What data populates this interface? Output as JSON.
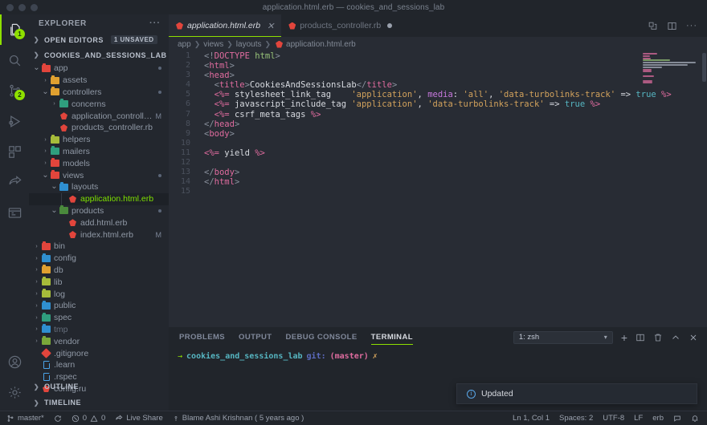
{
  "window": {
    "title": "application.html.erb — cookies_and_sessions_lab"
  },
  "activity_bar": {
    "items": [
      {
        "name": "explorer",
        "icon": "files-icon",
        "badge": "1",
        "active": true
      },
      {
        "name": "search",
        "icon": "search-icon",
        "badge": "",
        "active": false
      },
      {
        "name": "source-control",
        "icon": "source-control-icon",
        "badge": "2",
        "active": false
      },
      {
        "name": "run-and-debug",
        "icon": "run-debug-icon",
        "badge": "",
        "active": false
      },
      {
        "name": "extensions",
        "icon": "extensions-icon",
        "badge": "",
        "active": false
      },
      {
        "name": "live-share",
        "icon": "share-icon",
        "badge": "",
        "active": false
      },
      {
        "name": "remote-explorer",
        "icon": "remote-window-icon",
        "badge": "",
        "active": false
      }
    ],
    "bottom_items": [
      {
        "name": "accounts",
        "icon": "account-icon"
      },
      {
        "name": "manage-settings",
        "icon": "gear-icon"
      }
    ]
  },
  "sidebar": {
    "header": "EXPLORER",
    "more_actions": "···",
    "open_editors": {
      "label": "OPEN EDITORS",
      "badge": "1 UNSAVED",
      "collapsed": true
    },
    "project": {
      "label": "COOKIES_AND_SESSIONS_LAB",
      "collapsed": false
    },
    "tree": [
      {
        "label": "app",
        "type": "folder",
        "depth": 1,
        "open": true,
        "color": "#e2453c",
        "icon": "folder-app-icon",
        "flag": "",
        "dot": true
      },
      {
        "label": "assets",
        "type": "folder",
        "depth": 2,
        "open": false,
        "color": "#e0a030",
        "icon": "folder-assets-icon",
        "flag": "",
        "dot": false
      },
      {
        "label": "controllers",
        "type": "folder",
        "depth": 2,
        "open": true,
        "color": "#e0a030",
        "icon": "folder-controllers-icon",
        "flag": "",
        "dot": true
      },
      {
        "label": "concerns",
        "type": "folder",
        "depth": 3,
        "open": false,
        "color": "#2f9e7e",
        "icon": "folder-concerns-icon",
        "flag": "",
        "dot": false
      },
      {
        "label": "application_controller.rb",
        "type": "ruby",
        "depth": 3,
        "open": false,
        "color": "#e2453c",
        "icon": "ruby-file-icon",
        "flag": "M",
        "dot": false
      },
      {
        "label": "products_controller.rb",
        "type": "ruby",
        "depth": 3,
        "open": false,
        "color": "#e2453c",
        "icon": "ruby-file-icon",
        "flag": "",
        "dot": false
      },
      {
        "label": "helpers",
        "type": "folder",
        "depth": 2,
        "open": false,
        "color": "#a6bb3a",
        "icon": "folder-helpers-icon",
        "flag": "",
        "dot": false
      },
      {
        "label": "mailers",
        "type": "folder",
        "depth": 2,
        "open": false,
        "color": "#2f9e7e",
        "icon": "folder-mailers-icon",
        "flag": "",
        "dot": false
      },
      {
        "label": "models",
        "type": "folder",
        "depth": 2,
        "open": false,
        "color": "#e2453c",
        "icon": "folder-models-icon",
        "flag": "",
        "dot": false
      },
      {
        "label": "views",
        "type": "folder",
        "depth": 2,
        "open": true,
        "color": "#e2453c",
        "icon": "folder-views-icon",
        "flag": "",
        "dot": true
      },
      {
        "label": "layouts",
        "type": "folder",
        "depth": 3,
        "open": true,
        "color": "#2f8fd0",
        "icon": "folder-layouts-icon",
        "flag": "",
        "dot": false
      },
      {
        "label": "application.html.erb",
        "type": "ruby",
        "depth": 4,
        "open": false,
        "color": "#e2453c",
        "icon": "erb-file-icon",
        "flag": "",
        "dot": false,
        "selected": true
      },
      {
        "label": "products",
        "type": "folder",
        "depth": 3,
        "open": true,
        "color": "#4a8a3c",
        "icon": "folder-products-icon",
        "flag": "",
        "dot": true
      },
      {
        "label": "add.html.erb",
        "type": "ruby",
        "depth": 4,
        "open": false,
        "color": "#e2453c",
        "icon": "erb-file-icon",
        "flag": "",
        "dot": false
      },
      {
        "label": "index.html.erb",
        "type": "ruby",
        "depth": 4,
        "open": false,
        "color": "#e2453c",
        "icon": "erb-file-icon",
        "flag": "M",
        "dot": false
      },
      {
        "label": "bin",
        "type": "folder",
        "depth": 1,
        "open": false,
        "color": "#e2453c",
        "icon": "folder-bin-icon",
        "flag": "",
        "dot": false
      },
      {
        "label": "config",
        "type": "folder",
        "depth": 1,
        "open": false,
        "color": "#2f8fd0",
        "icon": "folder-config-icon",
        "flag": "",
        "dot": false
      },
      {
        "label": "db",
        "type": "folder",
        "depth": 1,
        "open": false,
        "color": "#e0a030",
        "icon": "folder-db-icon",
        "flag": "",
        "dot": false
      },
      {
        "label": "lib",
        "type": "folder",
        "depth": 1,
        "open": false,
        "color": "#a6bb3a",
        "icon": "folder-lib-icon",
        "flag": "",
        "dot": false
      },
      {
        "label": "log",
        "type": "folder",
        "depth": 1,
        "open": false,
        "color": "#a6bb3a",
        "icon": "folder-log-icon",
        "flag": "",
        "dot": false
      },
      {
        "label": "public",
        "type": "folder",
        "depth": 1,
        "open": false,
        "color": "#2f8fd0",
        "icon": "folder-public-icon",
        "flag": "",
        "dot": false
      },
      {
        "label": "spec",
        "type": "folder",
        "depth": 1,
        "open": false,
        "color": "#2f9e7e",
        "icon": "folder-spec-icon",
        "flag": "",
        "dot": false
      },
      {
        "label": "tmp",
        "type": "folder",
        "depth": 1,
        "open": false,
        "color": "#2f8fd0",
        "icon": "folder-tmp-icon",
        "flag": "",
        "dot": false,
        "dim": true
      },
      {
        "label": "vendor",
        "type": "folder",
        "depth": 1,
        "open": false,
        "color": "#7aa83a",
        "icon": "folder-vendor-icon",
        "flag": "",
        "dot": false
      },
      {
        "label": ".gitignore",
        "type": "git",
        "depth": 1,
        "open": false,
        "color": "#e2453c",
        "icon": "git-file-icon",
        "flag": "",
        "dot": false,
        "noChev": true
      },
      {
        "label": ".learn",
        "type": "file",
        "depth": 1,
        "open": false,
        "color": "#4aa3e8",
        "icon": "text-file-icon",
        "flag": "",
        "dot": false,
        "noChev": true
      },
      {
        "label": ".rspec",
        "type": "file",
        "depth": 1,
        "open": false,
        "color": "#4aa3e8",
        "icon": "text-file-icon",
        "flag": "",
        "dot": false,
        "noChev": true
      },
      {
        "label": "config.ru",
        "type": "ruby",
        "depth": 1,
        "open": false,
        "color": "#e2453c",
        "icon": "ruby-file-icon",
        "flag": "",
        "dot": false,
        "noChev": true
      }
    ],
    "footer": [
      {
        "label": "OUTLINE",
        "collapsed": true
      },
      {
        "label": "TIMELINE",
        "collapsed": true
      }
    ]
  },
  "editor": {
    "tabs": [
      {
        "label": "application.html.erb",
        "icon": "erb-file-icon",
        "active": true,
        "dirty": false,
        "closable": true
      },
      {
        "label": "products_controller.rb",
        "icon": "ruby-file-icon",
        "active": false,
        "dirty": true,
        "closable": false
      }
    ],
    "actions": [
      {
        "name": "split-editor-vertical-icon"
      },
      {
        "name": "split-editor-icon"
      },
      {
        "name": "more-actions-icon"
      }
    ],
    "breadcrumb": [
      "app",
      "views",
      "layouts",
      "application.html.erb"
    ],
    "lines": [
      {
        "n": "1",
        "tokens": [
          [
            "t-punct",
            "<!"
          ],
          [
            "t-doctype",
            "DOCTYPE"
          ],
          [
            "t-name",
            " html"
          ],
          [
            "t-punct",
            ">"
          ]
        ],
        "indent": 0
      },
      {
        "n": "2",
        "tokens": [
          [
            "t-punct",
            "<"
          ],
          [
            "t-tag",
            "html"
          ],
          [
            "t-punct",
            ">"
          ]
        ],
        "indent": 0
      },
      {
        "n": "3",
        "tokens": [
          [
            "t-punct",
            "<"
          ],
          [
            "t-tag",
            "head"
          ],
          [
            "t-punct",
            ">"
          ]
        ],
        "indent": 0
      },
      {
        "n": "4",
        "tokens": [
          [
            "t-punct",
            "  <"
          ],
          [
            "t-tag",
            "title"
          ],
          [
            "t-punct",
            ">"
          ],
          [
            "t-text",
            "CookiesAndSessionsLab"
          ],
          [
            "t-punct",
            "</"
          ],
          [
            "t-tag",
            "title"
          ],
          [
            "t-punct",
            ">"
          ]
        ],
        "indent": 0
      },
      {
        "n": "5",
        "tokens": [
          [
            "t-erb",
            "  <%= "
          ],
          [
            "t-fn",
            "stylesheet_link_tag"
          ],
          [
            "t-text",
            "    "
          ],
          [
            "t-str",
            "'application'"
          ],
          [
            "t-text",
            ", "
          ],
          [
            "t-attr",
            "media"
          ],
          [
            "t-text",
            ": "
          ],
          [
            "t-str",
            "'all'"
          ],
          [
            "t-text",
            ", "
          ],
          [
            "t-str",
            "'data-turbolinks-track'"
          ],
          [
            "t-text",
            " => "
          ],
          [
            "t-kw",
            "true"
          ],
          [
            "t-erb",
            " %>"
          ]
        ],
        "indent": 0
      },
      {
        "n": "6",
        "tokens": [
          [
            "t-erb",
            "  <%= "
          ],
          [
            "t-fn",
            "javascript_include_tag"
          ],
          [
            "t-text",
            " "
          ],
          [
            "t-str",
            "'application'"
          ],
          [
            "t-text",
            ", "
          ],
          [
            "t-str",
            "'data-turbolinks-track'"
          ],
          [
            "t-text",
            " => "
          ],
          [
            "t-kw",
            "true"
          ],
          [
            "t-erb",
            " %>"
          ]
        ],
        "indent": 0
      },
      {
        "n": "7",
        "tokens": [
          [
            "t-erb",
            "  <%= "
          ],
          [
            "t-fn",
            "csrf_meta_tags"
          ],
          [
            "t-erb",
            " %>"
          ]
        ],
        "indent": 0
      },
      {
        "n": "8",
        "tokens": [
          [
            "t-punct",
            "</"
          ],
          [
            "t-tag",
            "head"
          ],
          [
            "t-punct",
            ">"
          ]
        ],
        "indent": 0
      },
      {
        "n": "9",
        "tokens": [
          [
            "t-punct",
            "<"
          ],
          [
            "t-tag",
            "body"
          ],
          [
            "t-punct",
            ">"
          ]
        ],
        "indent": 0
      },
      {
        "n": "10",
        "tokens": [],
        "indent": 0
      },
      {
        "n": "11",
        "tokens": [
          [
            "t-erb",
            "<%= "
          ],
          [
            "t-fn",
            "yield"
          ],
          [
            "t-erb",
            " %>"
          ]
        ],
        "indent": 0
      },
      {
        "n": "12",
        "tokens": [],
        "indent": 0
      },
      {
        "n": "13",
        "tokens": [
          [
            "t-punct",
            "</"
          ],
          [
            "t-tag",
            "body"
          ],
          [
            "t-punct",
            ">"
          ]
        ],
        "indent": 0
      },
      {
        "n": "14",
        "tokens": [
          [
            "t-punct",
            "</"
          ],
          [
            "t-tag",
            "html"
          ],
          [
            "t-punct",
            ">"
          ]
        ],
        "indent": 0
      },
      {
        "n": "15",
        "tokens": [],
        "indent": 0
      }
    ]
  },
  "panel": {
    "tabs": [
      {
        "label": "PROBLEMS",
        "active": false
      },
      {
        "label": "OUTPUT",
        "active": false
      },
      {
        "label": "DEBUG CONSOLE",
        "active": false
      },
      {
        "label": "TERMINAL",
        "active": true
      }
    ],
    "terminal_select": "1: zsh",
    "actions": [
      {
        "name": "new-terminal-icon",
        "glyph": "+"
      },
      {
        "name": "split-terminal-icon",
        "glyph": "split"
      },
      {
        "name": "kill-terminal-icon",
        "glyph": "trash"
      },
      {
        "name": "maximize-panel-icon",
        "glyph": "chevron-up"
      },
      {
        "name": "close-panel-icon",
        "glyph": "close"
      }
    ],
    "prompt": {
      "arrow": "→",
      "dir": "cookies_and_sessions_lab",
      "git": "git:",
      "branch": "(master)",
      "marker": "✗"
    }
  },
  "toast": {
    "icon": "info-icon",
    "message": "Updated"
  },
  "statusbar": {
    "left": [
      {
        "name": "branch",
        "icon": "source-control-icon",
        "label": "master*"
      },
      {
        "name": "sync",
        "icon": "sync-icon",
        "label": ""
      },
      {
        "name": "problems",
        "icon": "error-warning-icon",
        "label": "0 ⚠ 0",
        "errors": "0",
        "warnings": "0"
      },
      {
        "name": "live-share",
        "icon": "live-share-icon",
        "label": "Live Share"
      },
      {
        "name": "git-blame",
        "icon": "blame-icon",
        "label": "Blame Ashi Krishnan ( 5 years ago )"
      }
    ],
    "right": [
      {
        "name": "cursor-position",
        "label": "Ln 1, Col 1"
      },
      {
        "name": "indentation",
        "label": "Spaces: 2"
      },
      {
        "name": "encoding",
        "label": "UTF-8"
      },
      {
        "name": "eol",
        "label": "LF"
      },
      {
        "name": "language-mode",
        "label": "erb"
      },
      {
        "name": "feedback",
        "icon": "feedback-icon",
        "label": ""
      },
      {
        "name": "notifications",
        "icon": "bell-icon",
        "label": ""
      }
    ]
  },
  "colors": {
    "accent_green": "#8ee000",
    "editor_bg": "#282c34",
    "chrome_bg": "#21252b",
    "sidebar_bg": "#23272e"
  }
}
